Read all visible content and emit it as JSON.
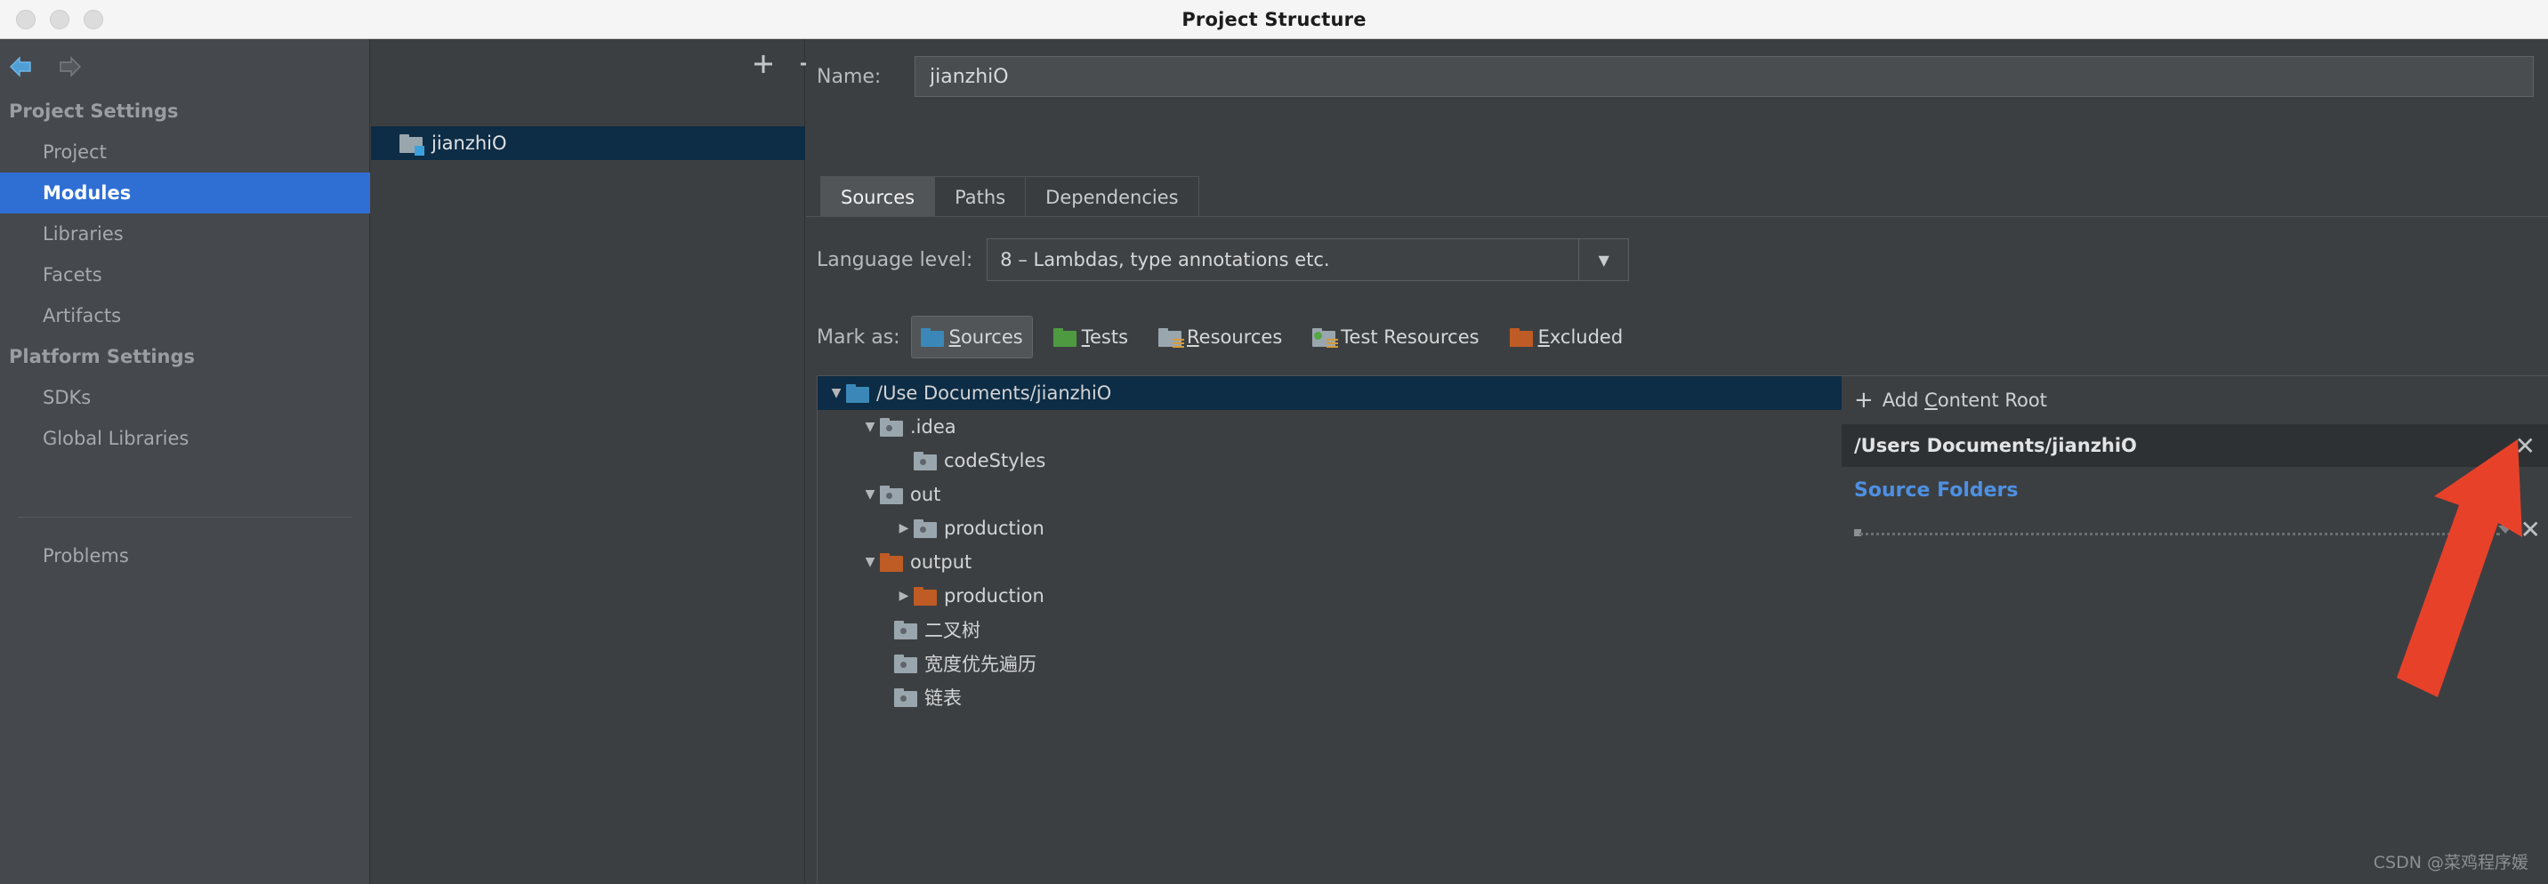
{
  "window": {
    "title": "Project Structure",
    "traffic_lights": [
      "close-button",
      "minimize-button",
      "maximize-button"
    ]
  },
  "sidebar": {
    "nav": {
      "back_icon": "arrow-left-icon",
      "forward_icon": "arrow-right-icon"
    },
    "groups": [
      {
        "label": "Project Settings",
        "items": [
          {
            "label": "Project",
            "selected": false
          },
          {
            "label": "Modules",
            "selected": true
          },
          {
            "label": "Libraries",
            "selected": false
          },
          {
            "label": "Facets",
            "selected": false
          },
          {
            "label": "Artifacts",
            "selected": false
          }
        ]
      },
      {
        "label": "Platform Settings",
        "items": [
          {
            "label": "SDKs",
            "selected": false
          },
          {
            "label": "Global Libraries",
            "selected": false
          }
        ]
      }
    ],
    "problems": {
      "label": "Problems"
    }
  },
  "module_list": {
    "toolbar": {
      "add_label": "+",
      "remove_label": "−",
      "copy_icon": "copy-icon"
    },
    "items": [
      {
        "label": "jianzhiO",
        "icon": "module-folder-icon",
        "selected": true
      }
    ]
  },
  "content": {
    "name": {
      "label": "Name:",
      "value": "jianzhiO",
      "placeholder": ""
    },
    "tabs": [
      {
        "label": "Sources",
        "active": true
      },
      {
        "label": "Paths",
        "active": false
      },
      {
        "label": "Dependencies",
        "active": false
      }
    ],
    "language_level": {
      "label": "Language level:",
      "value": "8 – Lambdas, type annotations etc.",
      "arrow_icon": "chevron-down-icon"
    },
    "mark_as": {
      "label": "Mark as:",
      "buttons": [
        {
          "label": "Sources",
          "mnemonic": "S",
          "color": "#3b88b8",
          "pressed": true
        },
        {
          "label": "Tests",
          "mnemonic": "T",
          "color": "#4e9a41",
          "pressed": false
        },
        {
          "label": "Resources",
          "mnemonic": "R",
          "color": "#9aa6ad",
          "pressed": false
        },
        {
          "label": "Test Resources",
          "mnemonic": "",
          "color": "#9aa6ad",
          "pressed": false
        },
        {
          "label": "Excluded",
          "mnemonic": "E",
          "color": "#bf5b24",
          "pressed": false
        }
      ]
    },
    "tree": [
      {
        "label": "/Use      Documents/jianzhiO",
        "depth": 0,
        "twisty": "▼",
        "folder": "blue",
        "selected": true
      },
      {
        "label": ".idea",
        "depth": 1,
        "twisty": "▼",
        "folder": "gray-dot",
        "selected": false
      },
      {
        "label": "codeStyles",
        "depth": 2,
        "twisty": "",
        "folder": "gray-dot",
        "selected": false
      },
      {
        "label": "out",
        "depth": 1,
        "twisty": "▼",
        "folder": "gray-dot",
        "selected": false
      },
      {
        "label": "production",
        "depth": 2,
        "twisty": "▶",
        "folder": "gray-dot",
        "selected": false
      },
      {
        "label": "output",
        "depth": 1,
        "twisty": "▼",
        "folder": "orange",
        "selected": false
      },
      {
        "label": "production",
        "depth": 2,
        "twisty": "▶",
        "folder": "orange",
        "selected": false
      },
      {
        "label": "二叉树",
        "depth": 2,
        "twisty": "",
        "folder": "gray-dot",
        "selected": false
      },
      {
        "label": "宽度优先遍历",
        "depth": 2,
        "twisty": "",
        "folder": "gray-dot",
        "selected": false
      },
      {
        "label": "链表",
        "depth": 2,
        "twisty": "",
        "folder": "gray-dot",
        "selected": false
      }
    ],
    "detail": {
      "add_content_root": {
        "prefix": "+",
        "label": "Add ",
        "mnemonic": "C",
        "label_rest": "ontent Root"
      },
      "content_root": {
        "path": "/Users      Documents/jianzhiO",
        "close_icon": "close-icon"
      },
      "source_folders_title": "Source Folders",
      "source_folder_close_icon": "close-icon"
    }
  },
  "annotation": {
    "arrow_icon": "red-arrow-icon",
    "color": "#e8412a"
  },
  "watermark": {
    "text": "CSDN @菜鸡程序媛"
  }
}
